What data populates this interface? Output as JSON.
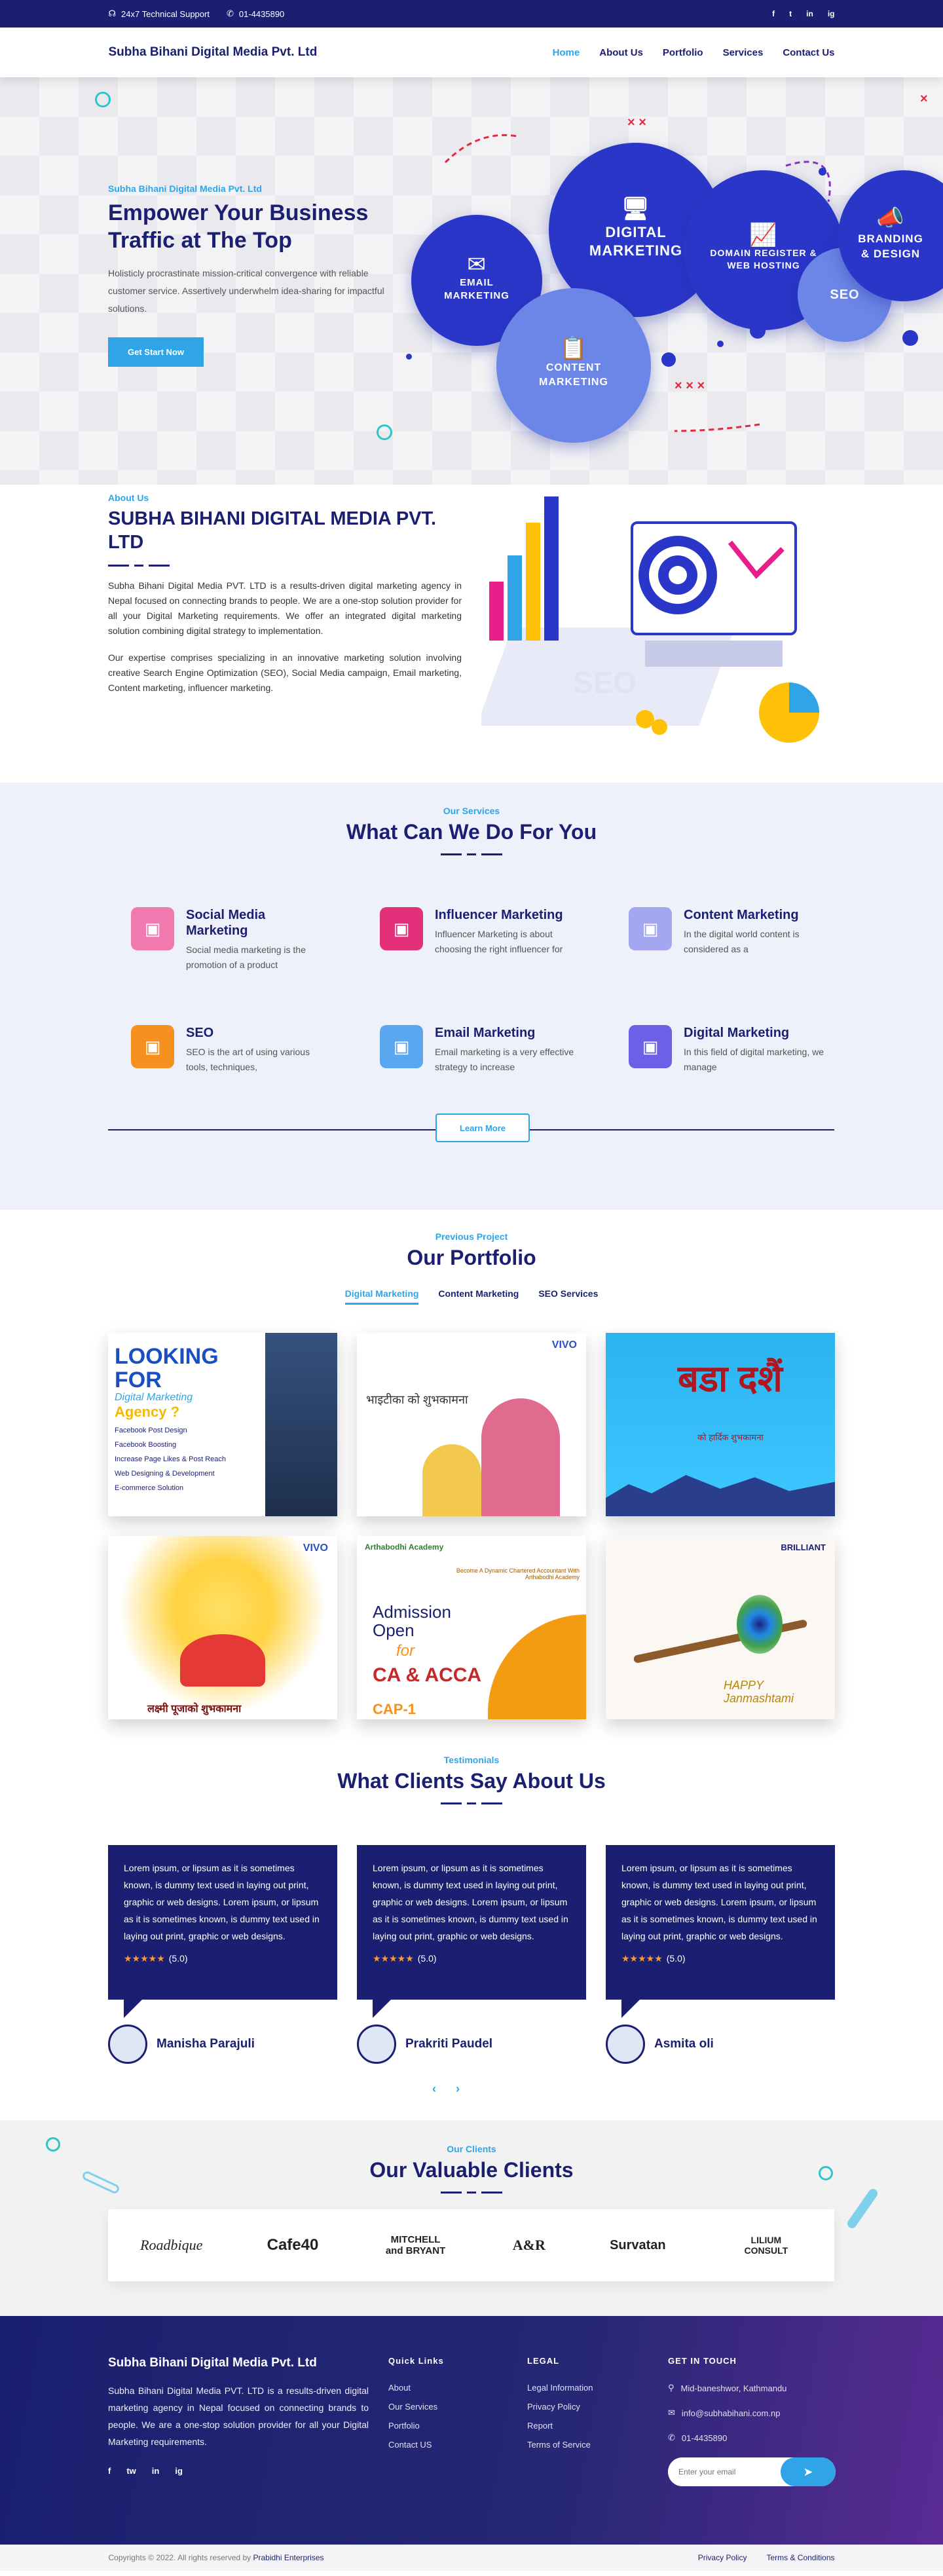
{
  "topbar": {
    "support": "24x7 Technical Support",
    "phone": "01-4435890",
    "social": [
      "f",
      "t",
      "in",
      "ig"
    ]
  },
  "nav": {
    "brand": "Subha Bihani Digital Media Pvt. Ltd",
    "items": [
      "Home",
      "About Us",
      "Portfolio",
      "Services",
      "Contact Us"
    ],
    "active": "Home"
  },
  "hero": {
    "eyebrow": "Subha Bihani Digital Media Pvt. Ltd",
    "title": "Empower Your Business Traffic at The Top",
    "text": "Holisticly procrastinate mission-critical convergence with reliable customer service. Assertively underwhelm idea-sharing for impactful solutions.",
    "cta": "Get Start Now",
    "bubbles": {
      "digital": "DIGITAL MARKETING",
      "email": "EMAIL MARKETING",
      "content": "CONTENT MARKETING",
      "domain": "DOMAIN REGISTER & WEB HOSTING",
      "branding": "BRANDING & DESIGN",
      "seo": "SEO"
    },
    "colors": {
      "blue": "#2a36c8",
      "light": "#6b86e6",
      "accent": "#2fa4e7"
    }
  },
  "about": {
    "eyebrow": "About Us",
    "title": "SUBHA BIHANI DIGITAL MEDIA PVT. LTD",
    "p1": "Subha Bihani Digital Media PVT. LTD is a results-driven digital marketing agency in Nepal focused on connecting brands to people. We are a one-stop solution provider for all your Digital Marketing requirements. We offer an integrated digital marketing solution combining digital strategy to implementation.",
    "p2": "Our expertise comprises specializing in an innovative marketing solution involving creative Search Engine Optimization (SEO), Social Media campaign, Email marketing, Content marketing, influencer marketing."
  },
  "services": {
    "eyebrow": "Our Services",
    "title": "What Can We Do For You",
    "items": [
      {
        "title": "Social Media Marketing",
        "text": "Social media marketing is the promotion of a product",
        "icon": "social-media-icon",
        "color": "#f07ab0"
      },
      {
        "title": "Influencer Marketing",
        "text": "Influencer Marketing is about choosing the right influencer for",
        "icon": "influencer-icon",
        "color": "#e2317a"
      },
      {
        "title": "Content Marketing",
        "text": "In the digital world content is considered as a",
        "icon": "content-icon",
        "color": "#a3a7f0"
      },
      {
        "title": "SEO",
        "text": "SEO is the art of using various tools, techniques,",
        "icon": "seo-icon",
        "color": "#f6901e"
      },
      {
        "title": "Email Marketing",
        "text": "Email marketing is a very effective strategy to increase",
        "icon": "email-icon",
        "color": "#5aa7f0"
      },
      {
        "title": "Digital Marketing",
        "text": "In this field of digital marketing, we manage",
        "icon": "digital-icon",
        "color": "#6c61e6"
      }
    ],
    "learn_more": "Learn More"
  },
  "portfolio": {
    "eyebrow": "Previous Project",
    "title": "Our Portfolio",
    "tabs": [
      "Digital Marketing",
      "Content Marketing",
      "SEO Services"
    ],
    "cards": [
      {
        "heading": "LOOKING FOR",
        "sub": "Digital Marketing",
        "sub2": "Agency ?",
        "list": [
          "Facebook Post Design",
          "Facebook Boosting",
          "Increase Page Likes & Post Reach",
          "Web Designing & Development",
          "E-commerce Solution"
        ]
      },
      {
        "heading": "भाइटीका को शुभकामना",
        "brand": "VIVO"
      },
      {
        "heading": "बडा दशैं",
        "sub": "को हार्दिक शुभकामना"
      },
      {
        "heading": "लक्ष्मी पूजाको शुभकामना",
        "brand": "VIVO"
      },
      {
        "heading": "Admission Open",
        "sub": "for",
        "course": "CA & ACCA",
        "tag": "CAP-1",
        "brand": "Arthabodhi Academy",
        "note": "Become A Dynamic Chartered Accountant With Arthabodhi Academy"
      },
      {
        "heading": "HAPPY Janmashtami",
        "brand": "BRILLIANT"
      }
    ]
  },
  "testimonials": {
    "eyebrow": "Testimonials",
    "title": "What Clients Say About Us",
    "items": [
      {
        "text": "Lorem ipsum, or lipsum as it is sometimes known, is dummy text used in laying out print, graphic or web designs. Lorem ipsum, or lipsum as it is sometimes known, is dummy text used in laying out print, graphic or web designs.",
        "stars": "★★★★★",
        "score": "(5.0)",
        "name": "Manisha Parajuli"
      },
      {
        "text": "Lorem ipsum, or lipsum as it is sometimes known, is dummy text used in laying out print, graphic or web designs. Lorem ipsum, or lipsum as it is sometimes known, is dummy text used in laying out print, graphic or web designs.",
        "stars": "★★★★★",
        "score": "(5.0)",
        "name": "Prakriti Paudel"
      },
      {
        "text": "Lorem ipsum, or lipsum as it is sometimes known, is dummy text used in laying out print, graphic or web designs. Lorem ipsum, or lipsum as it is sometimes known, is dummy text used in laying out print, graphic or web designs.",
        "stars": "★★★★★",
        "score": "(5.0)",
        "name": "Asmita oli"
      }
    ],
    "prev": "‹",
    "next": "›"
  },
  "clients": {
    "eyebrow": "Our Clients",
    "title": "Our Valuable Clients",
    "logos": [
      "Roadbique",
      "Cafe40",
      "MITCHELL and BRYANT",
      "A&R",
      "Survatan",
      "LILIUM CONSULT"
    ]
  },
  "footer": {
    "brand": "Subha Bihani Digital Media Pvt. Ltd",
    "about": "Subha Bihani Digital Media PVT. LTD is a results-driven digital marketing agency in Nepal focused on connecting brands to people. We are a one-stop solution provider for all your Digital Marketing requirements.",
    "social": [
      "f",
      "tw",
      "in",
      "ig"
    ],
    "quick_title": "Quick Links",
    "quick": [
      "About",
      "Our Services",
      "Portfolio",
      "Contact US"
    ],
    "legal_title": "LEGAL",
    "legal": [
      "Legal Information",
      "Privacy Policy",
      "Report",
      "Terms of Service"
    ],
    "contact_title": "GET IN TOUCH",
    "address": "Mid-baneshwor, Kathmandu",
    "email": "info@subhabihani.com.np",
    "phone": "01-4435890",
    "email_placeholder": "Enter your email"
  },
  "bottombar": {
    "copyright": "Copyrights © 2022. All rights reserved by",
    "company": "Prabidhi Enterprises",
    "privacy": "Privacy Policy",
    "terms": "Terms & Conditions"
  }
}
